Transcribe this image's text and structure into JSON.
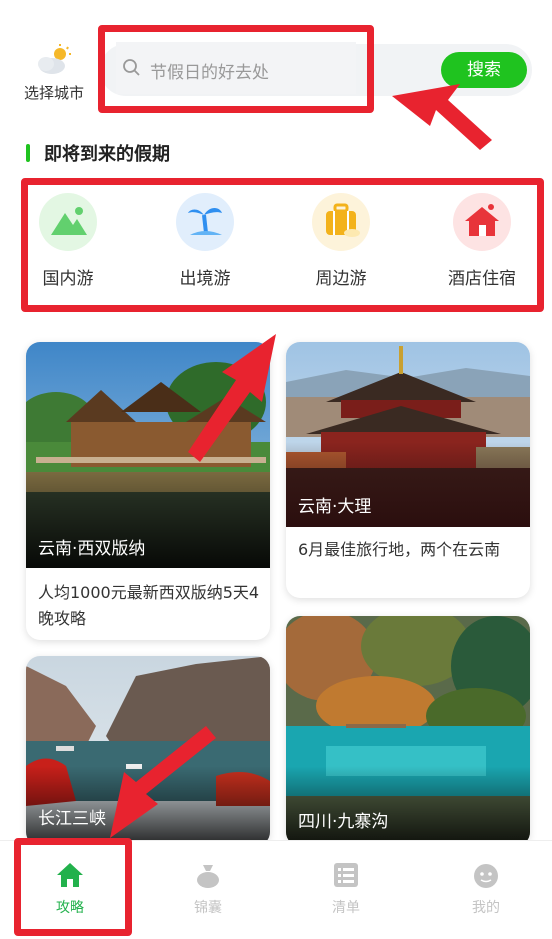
{
  "header": {
    "city_label": "选择城市",
    "search_placeholder": "节假日的好去处",
    "search_button": "搜索"
  },
  "section": {
    "title": "即将到来的假期"
  },
  "categories": [
    {
      "label": "国内游",
      "icon": "mountain-icon",
      "color": "#62d06e",
      "bg": "#e3f7e3"
    },
    {
      "label": "出境游",
      "icon": "palm-tree-icon",
      "color": "#2f8ff0",
      "bg": "#e1eefc"
    },
    {
      "label": "周边游",
      "icon": "luggage-icon",
      "color": "#f3b21b",
      "bg": "#fdf3da"
    },
    {
      "label": "酒店住宿",
      "icon": "hotel-icon",
      "color": "#e8343a",
      "bg": "#fde3e3"
    }
  ],
  "cards": [
    {
      "place": "云南·西双版纳",
      "desc": "人均1000元最新西双版纳5天4晚攻略"
    },
    {
      "place": "云南·大理",
      "desc": "6月最佳旅行地，两个在云南"
    },
    {
      "place": "长江三峡",
      "desc": ""
    },
    {
      "place": "四川·九寨沟",
      "desc": ""
    }
  ],
  "tabs": [
    {
      "label": "攻略",
      "icon": "home-icon",
      "active": true
    },
    {
      "label": "锦囊",
      "icon": "bag-icon",
      "active": false
    },
    {
      "label": "清单",
      "icon": "list-icon",
      "active": false
    },
    {
      "label": "我的",
      "icon": "profile-icon",
      "active": false
    }
  ],
  "colors": {
    "accent": "#1fc31f",
    "highlight": "#e8232f",
    "tab_active": "#22b14c",
    "tab_inactive": "#c4c4c4"
  }
}
